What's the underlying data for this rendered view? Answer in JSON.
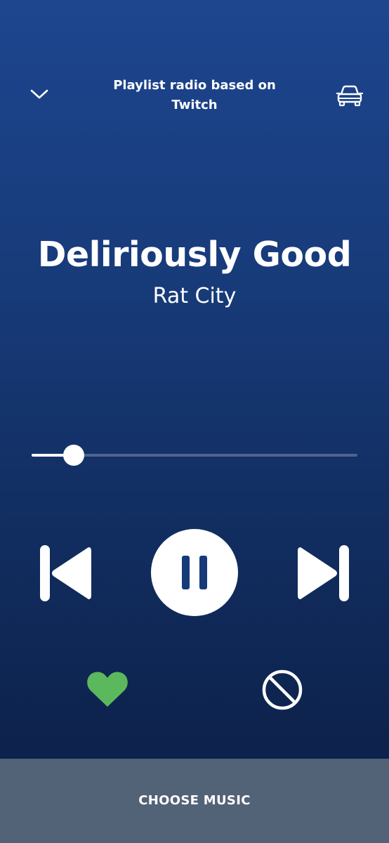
{
  "header": {
    "context_line1": "Playlist radio based on",
    "context_line2": "Twitch",
    "collapse_icon": "chevron-down-icon",
    "car_icon": "car-icon"
  },
  "track": {
    "title": "Deliriously Good",
    "artist": "Rat City"
  },
  "playback": {
    "progress_fraction": 0.13,
    "state": "playing",
    "liked": true
  },
  "controls": {
    "previous_icon": "skip-previous-icon",
    "pause_icon": "pause-icon",
    "next_icon": "skip-next-icon",
    "like_icon": "heart-icon",
    "block_icon": "block-icon"
  },
  "footer": {
    "choose_music_label": "CHOOSE MUSIC"
  },
  "colors": {
    "background_top": "#1d468f",
    "background_bottom": "#0b1e44",
    "accent_like": "#5cb85c",
    "footer_bar": "#526277",
    "text": "#ffffff"
  }
}
